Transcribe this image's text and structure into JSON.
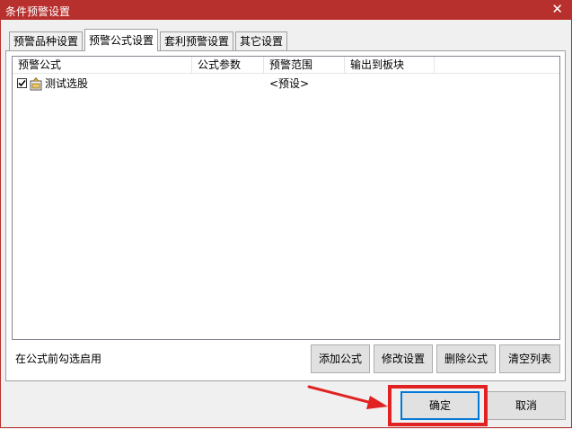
{
  "window": {
    "title": "条件预警设置",
    "close_glyph": "✕"
  },
  "tabs": [
    {
      "label": "预警品种设置"
    },
    {
      "label": "预警公式设置"
    },
    {
      "label": "套利预警设置"
    },
    {
      "label": "其它设置"
    }
  ],
  "table": {
    "columns": [
      "预警公式",
      "公式参数",
      "预警范围",
      "输出到板块"
    ],
    "rows": [
      {
        "checked": true,
        "formula": "测试选股",
        "params": "",
        "range": "<预设>",
        "output": ""
      }
    ]
  },
  "hint": "在公式前勾选启用",
  "panel_buttons": [
    "添加公式",
    "修改设置",
    "删除公式",
    "清空列表"
  ],
  "dialog_buttons": {
    "ok": "确定",
    "cancel": "取消"
  },
  "annotation_color": "#e02222"
}
